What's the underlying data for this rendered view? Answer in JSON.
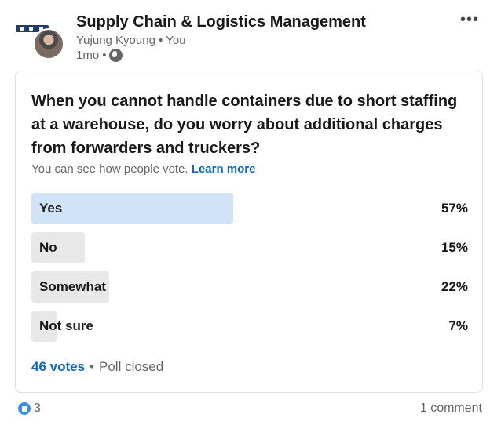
{
  "post": {
    "group_name": "Supply Chain & Logistics Management",
    "author": "Yujung Kyoung",
    "author_badge": "You",
    "time": "1mo",
    "visibility_icon": "globe-icon"
  },
  "poll": {
    "question": "When you cannot handle containers due to short staffing at a warehouse, do you worry about additional charges from forwarders and truckers?",
    "visibility_note": "You can see how people vote.",
    "learn_more": "Learn more",
    "options": [
      {
        "label": "Yes",
        "percent": "57%",
        "value": 57,
        "selected": true
      },
      {
        "label": "No",
        "percent": "15%",
        "value": 15,
        "selected": false
      },
      {
        "label": "Somewhat",
        "percent": "22%",
        "value": 22,
        "selected": false
      },
      {
        "label": "Not sure",
        "percent": "7%",
        "value": 7,
        "selected": false
      }
    ],
    "votes": "46 votes",
    "status": "Poll closed"
  },
  "social": {
    "reactions": "3",
    "comments": "1 comment"
  },
  "colors": {
    "accent": "#0a66c2",
    "selected_bar": "#d0e3f7",
    "bar": "#e8e8e8"
  }
}
